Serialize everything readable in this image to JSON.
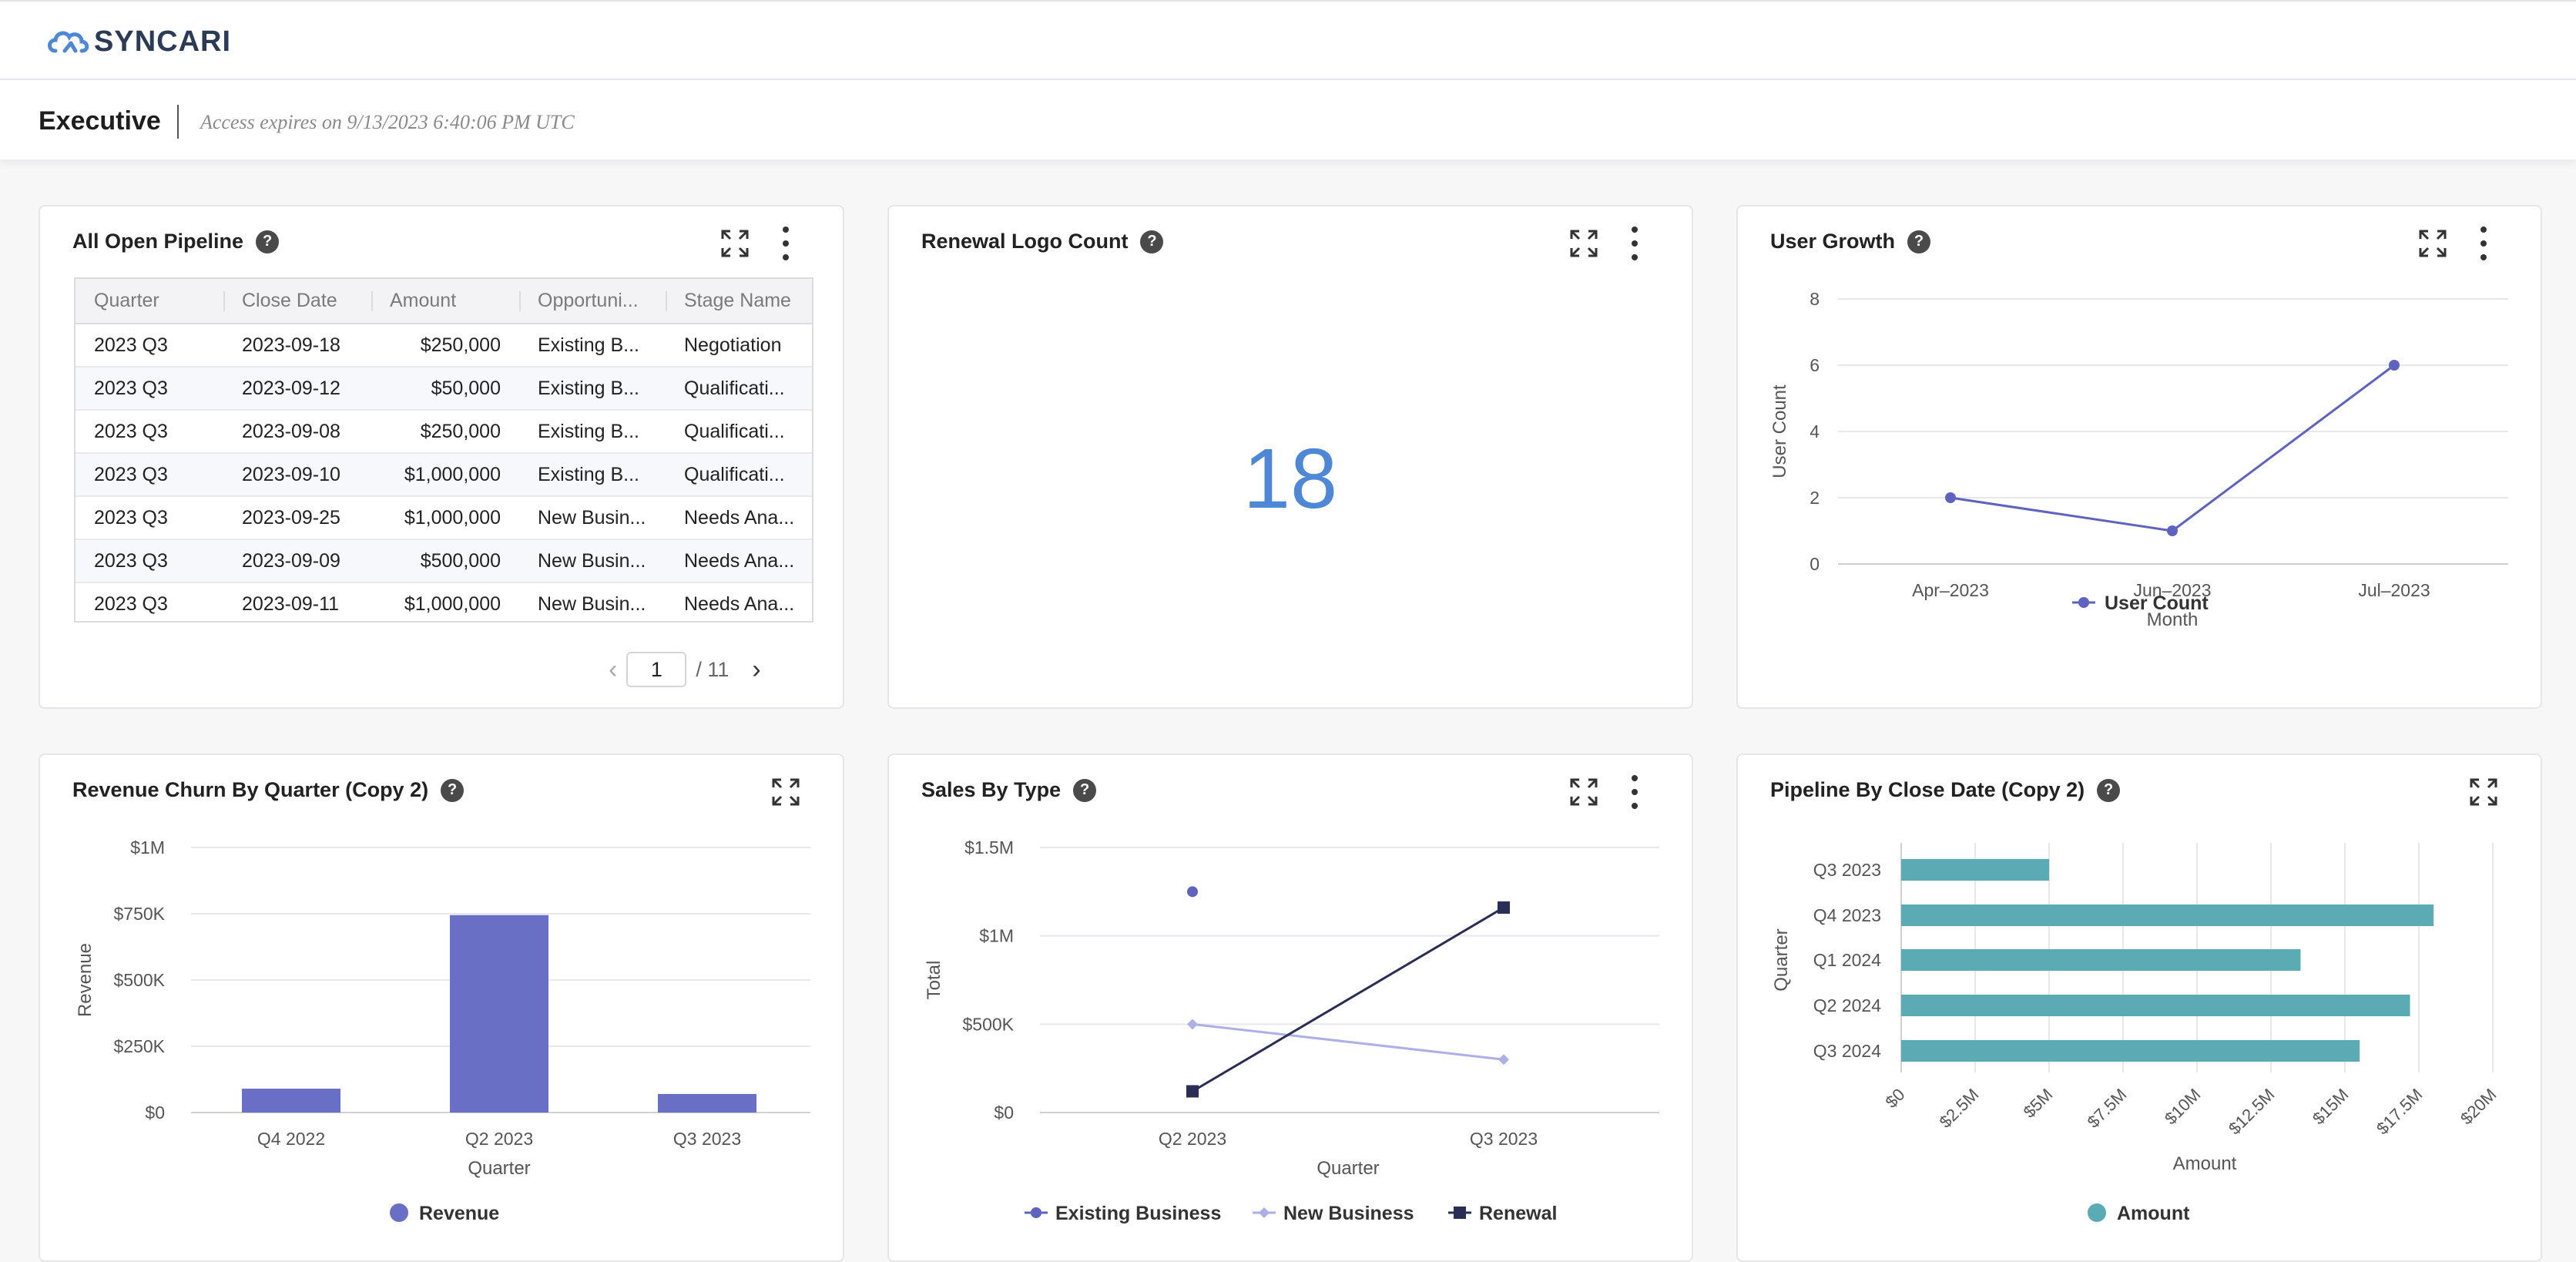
{
  "header": {
    "brand": "SYNCARI",
    "dashboard_title": "Executive",
    "access_expires": "Access expires on 9/13/2023 6:40:06 PM UTC"
  },
  "colors": {
    "accent": "#4d87d6",
    "bar_purple": "#6a6fc6",
    "teal": "#5aabb3",
    "navy": "#2a2e55",
    "lavender": "#adb0e6"
  },
  "cards": {
    "pipeline": {
      "title": "All Open Pipeline",
      "columns": [
        "Quarter",
        "Close Date",
        "Amount",
        "Opportuni...",
        "Stage Name"
      ],
      "rows": [
        [
          "2023 Q3",
          "2023-09-18",
          "$250,000",
          "Existing B...",
          "Negotiation"
        ],
        [
          "2023 Q3",
          "2023-09-12",
          "$50,000",
          "Existing B...",
          "Qualificati..."
        ],
        [
          "2023 Q3",
          "2023-09-08",
          "$250,000",
          "Existing B...",
          "Qualificati..."
        ],
        [
          "2023 Q3",
          "2023-09-10",
          "$1,000,000",
          "Existing B...",
          "Qualificati..."
        ],
        [
          "2023 Q3",
          "2023-09-25",
          "$1,000,000",
          "New Busin...",
          "Needs Ana..."
        ],
        [
          "2023 Q3",
          "2023-09-09",
          "$500,000",
          "New Busin...",
          "Needs Ana..."
        ],
        [
          "2023 Q3",
          "2023-09-11",
          "$1,000,000",
          "New Busin...",
          "Needs Ana..."
        ]
      ],
      "page_current": "1",
      "page_total": "/ 11"
    },
    "renewal": {
      "title": "Renewal Logo Count",
      "value": "18"
    },
    "user_growth": {
      "title": "User Growth"
    },
    "revenue_churn": {
      "title": "Revenue Churn By Quarter (Copy 2)"
    },
    "sales_by_type": {
      "title": "Sales By Type"
    },
    "pipeline_close": {
      "title": "Pipeline By Close Date (Copy 2)"
    }
  },
  "chart_data": [
    {
      "id": "user_growth",
      "type": "line",
      "categories": [
        "Apr–2023",
        "Jun–2023",
        "Jul–2023"
      ],
      "series": [
        {
          "name": "User Count",
          "values": [
            2,
            1,
            6
          ]
        }
      ],
      "xlabel": "Month",
      "ylabel": "User Count",
      "yticks": [
        "0",
        "2",
        "4",
        "6",
        "8"
      ],
      "ylim": [
        0,
        8
      ],
      "grid": true,
      "legend": "bottom"
    },
    {
      "id": "revenue_churn",
      "type": "bar",
      "categories": [
        "Q4 2022",
        "Q2 2023",
        "Q3 2023"
      ],
      "series": [
        {
          "name": "Revenue",
          "values": [
            90000,
            745000,
            70000
          ]
        }
      ],
      "xlabel": "Quarter",
      "ylabel": "Revenue",
      "yticks": [
        "$0",
        "$250K",
        "$500K",
        "$750K",
        "$1M"
      ],
      "ylim": [
        0,
        1000000
      ],
      "grid": true,
      "legend": "bottom"
    },
    {
      "id": "sales_by_type",
      "type": "line",
      "categories": [
        "Q2 2023",
        "Q3 2023"
      ],
      "series": [
        {
          "name": "Existing Business",
          "values": [
            1250000,
            null
          ]
        },
        {
          "name": "New Business",
          "values": [
            500000,
            300000
          ]
        },
        {
          "name": "Renewal",
          "values": [
            120000,
            1160000
          ]
        }
      ],
      "xlabel": "Quarter",
      "ylabel": "Total",
      "yticks": [
        "$0",
        "$500K",
        "$1M",
        "$1.5M"
      ],
      "ylim": [
        0,
        1500000
      ],
      "grid": true,
      "legend": "bottom"
    },
    {
      "id": "pipeline_close",
      "type": "bar",
      "orientation": "horizontal",
      "categories": [
        "Q3 2023",
        "Q4 2023",
        "Q1 2024",
        "Q2 2024",
        "Q3 2024"
      ],
      "series": [
        {
          "name": "Amount",
          "values": [
            5000000,
            18000000,
            13500000,
            17200000,
            15500000
          ]
        }
      ],
      "xlabel": "Amount",
      "ylabel": "Quarter",
      "xticks": [
        "$0",
        "$2.5M",
        "$5M",
        "$7.5M",
        "$10M",
        "$12.5M",
        "$15M",
        "$17.5M",
        "$20M"
      ],
      "xlim": [
        0,
        20000000
      ],
      "grid": true,
      "legend": "bottom"
    }
  ]
}
